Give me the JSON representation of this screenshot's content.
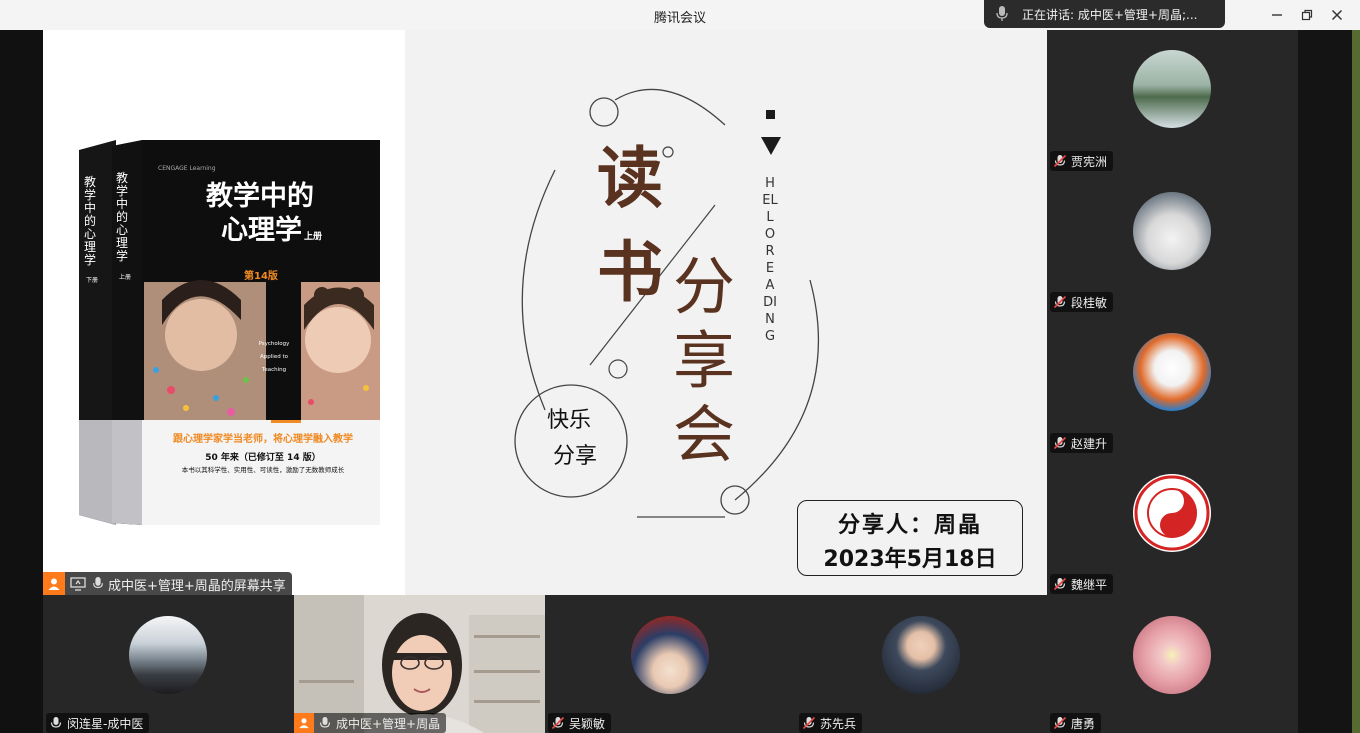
{
  "window": {
    "title": "腾讯会议"
  },
  "speaking": {
    "label": "正在讲话: 成中医+管理+周晶;..."
  },
  "share_tag": {
    "label": "成中医+管理+周晶的屏幕共享"
  },
  "book": {
    "title_line1": "教学中的",
    "title_line2": "心理学",
    "volume": "上册",
    "edition": "第14版",
    "english": "Psychology Applied to Teaching",
    "slogan": "跟心理学家学当老师，将心理学融入教学",
    "tagline1": "50 年来（已修订至 14 版）",
    "tagline2": "本书以其科学性、实用性、可读性，激励了无数教师成长",
    "spine1": "教学中的心理学",
    "spine2": "教学中的心理学",
    "spine_sub1": "下册",
    "spine_sub2": "上册",
    "publisher_logo": "CENGAGE Learning"
  },
  "slide": {
    "word1": "读",
    "word2": "书",
    "word3": "分",
    "word4": "享",
    "word5": "会",
    "vertical_en": "HELLO READING",
    "circle_text1": "快乐",
    "circle_text2": "分享",
    "presenter": "分享人：周晶",
    "date": "2023年5月18日"
  },
  "participants_right": [
    {
      "name": "贾宪洲"
    },
    {
      "name": "段桂敏"
    },
    {
      "name": "赵建升"
    },
    {
      "name": "魏继平"
    }
  ],
  "participants_bottom": [
    {
      "name": "闵连星-成中医"
    },
    {
      "name": "成中医+管理+周晶"
    },
    {
      "name": "吴颖敏"
    },
    {
      "name": "苏先兵"
    },
    {
      "name": "唐勇"
    }
  ],
  "colors": {
    "accent_orange": "#ff7a1a",
    "slide_brown": "#5a3220",
    "dark_bg": "#272727"
  }
}
